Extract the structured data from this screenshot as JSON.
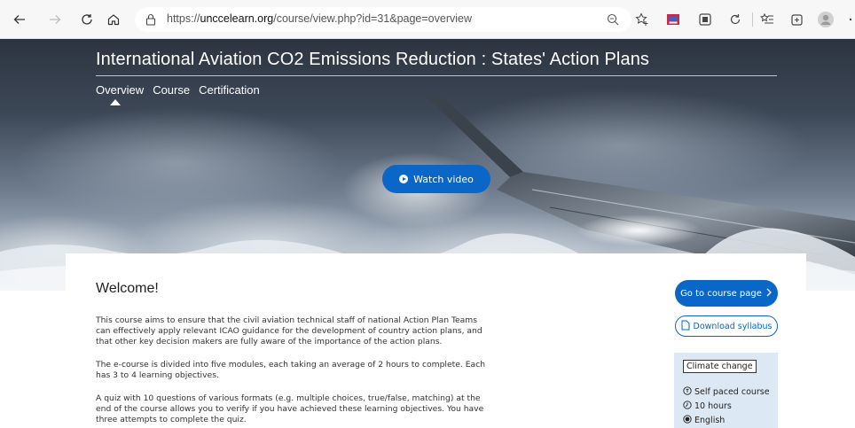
{
  "browser": {
    "url_prefix": "https://",
    "url_domain": "unccelearn.org",
    "url_path": "/course/view.php?id=31&page=overview"
  },
  "hero": {
    "title": "International Aviation CO2 Emissions Reduction : States' Action Plans",
    "tabs": [
      "Overview",
      "Course",
      "Certification"
    ],
    "watch_label": "Watch video"
  },
  "content": {
    "heading": "Welcome!",
    "paragraphs": [
      "This course aims to ensure that the civil aviation technical staff of national Action Plan Teams can effectively apply relevant ICAO guidance for the development of country action plans, and that other key decision makers are fully aware of the importance of the action plans.",
      "The e-course is divided into five modules, each taking an average of 2 hours to complete. Each has 3 to 4 learning objectives.",
      "A quiz with 10 questions of various formats (e.g. multiple choices, true/false, matching) at the end of the course allows you to verify if you have achieved these learning objectives. You have three attempts to complete the quiz."
    ]
  },
  "sidebar": {
    "go_label": "Go to course page",
    "download_label": "Download syllabus",
    "tag": "Climate change",
    "pace": "Self paced course",
    "duration": "10 hours",
    "language": "English"
  },
  "colors": {
    "accent": "#0a67c7",
    "info_bg": "#dce8f3"
  }
}
